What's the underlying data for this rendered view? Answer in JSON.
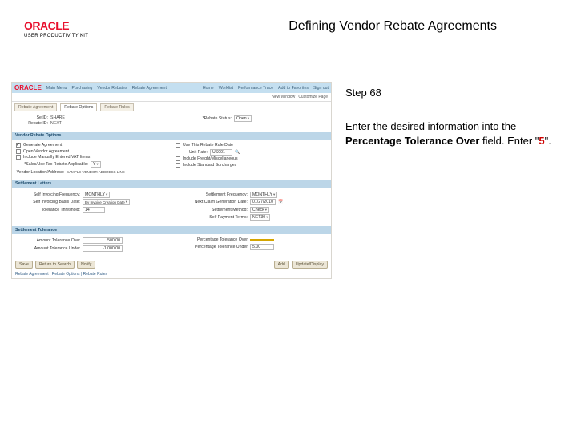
{
  "header": {
    "brand": "ORACLE",
    "upk": "USER PRODUCTIVITY KIT",
    "title": "Defining Vendor Rebate Agreements"
  },
  "sidebar": {
    "step": "Step 68",
    "instr_pre": "Enter the desired information into the ",
    "instr_field": "Percentage Tolerance Over",
    "instr_mid": " field. Enter \"",
    "instr_val": "5",
    "instr_post": "\"."
  },
  "app": {
    "nav": {
      "n1": "Main Menu",
      "n2": "Purchasing",
      "n3": "Vendor Rebates",
      "n4": "Rebate Agreement"
    },
    "links": {
      "l1": "Home",
      "l2": "Worklist",
      "l3": "Performance Trace",
      "l4": "Add to Favorites",
      "l5": "Sign out"
    },
    "sub": "New Window | Customize Page",
    "tabs": {
      "t1": "Rebate Agreement",
      "t2": "Rebate Options",
      "t3": "Rebate Rules"
    },
    "top": {
      "setid_l": "SetID:",
      "setid_v": "SHARE",
      "rebateid_l": "Rebate ID:",
      "rebateid_v": "NEXT",
      "status_l": "*Rebate Status:",
      "status_v": "Open"
    },
    "opts": {
      "title": "Vendor Rebate Options",
      "c1": "Generate Agreement",
      "c2": "Open Vendor Agreement",
      "c3": "Include Manually Entered VAT Items",
      "r1": "Use This Rebate Rule Date",
      "sales_l": "*Sales/Use Tax Rebate Applicable:",
      "sales_v": "Y",
      "unit_l": "Unit Rate:",
      "unit_v": "US001",
      "inc1": "Include Freight/Miscellaneous",
      "inc2": "Include Standard Surcharges",
      "venloc_l": "Vendor Location/Address:",
      "venloc_v": "SAMPLE VENDOR ADDRESS LINE"
    },
    "letters": {
      "title": "Settlement Letters",
      "freq_l": "Self Invoicing Frequency:",
      "freq_v": "MONTHLY",
      "basis_l": "Self Invoicing Basis Date:",
      "basis_v": "By Invoice Creation Date",
      "tol_l": "Tolerance Threshold:",
      "tol_v": "14",
      "setfreq_l": "Settlement Frequency:",
      "setfreq_v": "MONTHLY",
      "nextclaim_l": "Next Claim Generation Date:",
      "nextclaim_v": "01/27/2010",
      "method_l": "Settlement Method:",
      "method_v": "Check",
      "payterms_l": "Self Payment Terms:",
      "payterms_v": "NET30"
    },
    "settol": {
      "title": "Settlement Tolerance",
      "ato_l": "Amount Tolerance Over",
      "ato_v": "500.00",
      "atu_l": "Amount Tolerance Under",
      "atu_v": "-1,000.00",
      "pto_l": "Percentage Tolerance Over",
      "pto_v": "",
      "ptu_l": "Percentage Tolerance Under",
      "ptu_v": "5.00"
    },
    "buttons": {
      "save": "Save",
      "ret": "Return to Search",
      "notify": "Notify",
      "add": "Add",
      "upd": "Update/Display"
    },
    "footerlink": "Rebate Agreement | Rebate Options | Rebate Rules"
  }
}
